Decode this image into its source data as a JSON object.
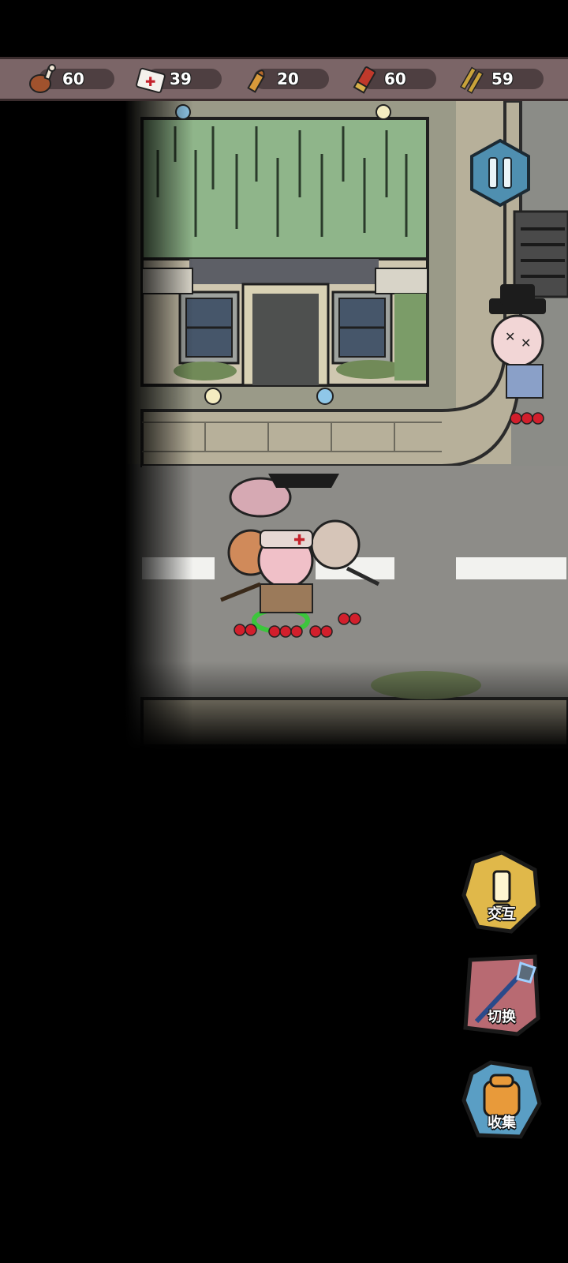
{
  "resources": [
    {
      "name": "food",
      "icon": "meat-drumstick-icon",
      "value": "60"
    },
    {
      "name": "medkit",
      "icon": "medkit-icon",
      "value": "39"
    },
    {
      "name": "pistol-ammo",
      "icon": "bullet-icon",
      "value": "20"
    },
    {
      "name": "shotgun-shells",
      "icon": "shotgun-shell-icon",
      "value": "60"
    },
    {
      "name": "rifle-ammo",
      "icon": "rifle-bullets-icon",
      "value": "59"
    }
  ],
  "actions": {
    "interact": {
      "label": "交互",
      "icon": "exclamation-icon"
    },
    "switch": {
      "label": "切换",
      "icon": "shovel-swap-icon"
    },
    "collect": {
      "label": "收集",
      "icon": "backpack-icon"
    }
  },
  "colors": {
    "resource_bar": "#7b6567",
    "road": "#8a8a86",
    "roof": "#8fb58a",
    "interact_btn": "#e0b84a",
    "switch_btn": "#b86a72",
    "collect_btn": "#5a9ec4"
  }
}
